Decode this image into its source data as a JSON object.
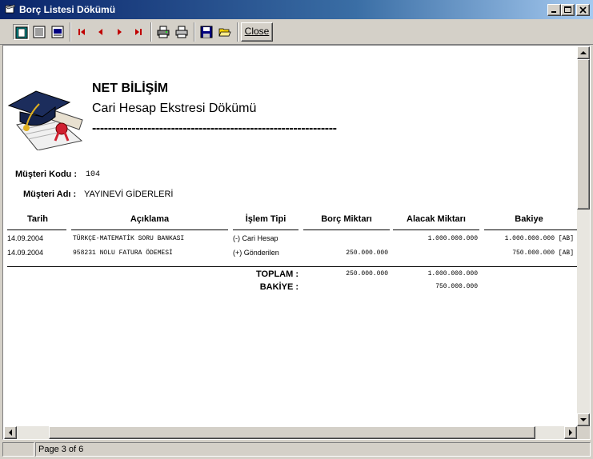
{
  "window": {
    "title": "Borç Listesi Dökümü"
  },
  "toolbar": {
    "close_label": "Close",
    "buttons": [
      "whole-page-icon",
      "page-width-icon",
      "zoom-100-icon",
      "first-page-icon",
      "prev-page-icon",
      "next-page-icon",
      "last-page-icon",
      "printer-setup-icon",
      "print-icon",
      "save-icon",
      "open-icon"
    ]
  },
  "report": {
    "company": "NET BİLİŞİM",
    "title": "Cari Hesap Ekstresi Dökümü",
    "dash_line": "--------------------------------------------------------------",
    "customer_code_label": "Müşteri Kodu :",
    "customer_code": "104",
    "customer_name_label": "Müşteri Adı :",
    "customer_name": "YAYINEVİ GİDERLERİ",
    "columns": [
      "Tarih",
      "Açıklama",
      "İşlem Tipi",
      "Borç Miktarı",
      "Alacak Miktarı",
      "Bakiye"
    ],
    "rows": [
      {
        "date": "14.09.2004",
        "desc": "TÜRKÇE-MATEMATİK SORU BANKASI",
        "type": "(-) Cari Hesap",
        "debit": "",
        "credit": "1.000.000.000",
        "balance": "1.000.000.000 [AB]"
      },
      {
        "date": "14.09.2004",
        "desc": "958231 NOLU FATURA ÖDEMESİ",
        "type": "(+) Gönderilen",
        "debit": "250.000.000",
        "credit": "",
        "balance": "750.000.000 [AB]"
      }
    ],
    "total_label": "TOPLAM :",
    "total_debit": "250.000.000",
    "total_credit": "1.000.000.000",
    "balance_label": "BAKİYE :",
    "balance_value": "750.000.000"
  },
  "status": {
    "page_text": "Page 3 of 6"
  }
}
